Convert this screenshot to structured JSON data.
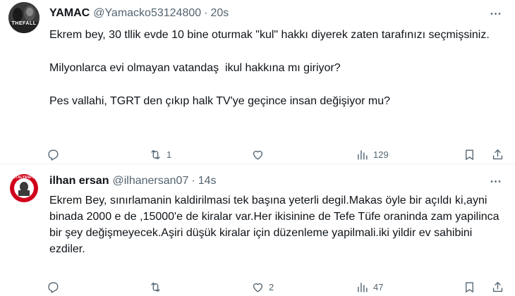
{
  "colors": {
    "text_primary": "#0f1419",
    "text_secondary": "#536471",
    "divider": "#eff3f4",
    "background": "#ffffff"
  },
  "tweets": [
    {
      "name": "YAMAC",
      "handle": "@Yamacko53124800",
      "dot": "·",
      "time": "20s",
      "avatar_text": "THEFALL",
      "paragraphs": [
        "Ekrem bey, 30 tllik evde 10 bine oturmak \"kul\" hakkı diyerek zaten tarafınızı seçmişsiniz.",
        "Milyonlarca evi olmayan vatandaş  ikul hakkına mı giriyor?",
        "Pes vallahi, TGRT den çıkıp halk TV'ye geçince insan değişiyor mu?"
      ],
      "actions": {
        "replies": "",
        "retweets": "1",
        "likes": "",
        "views": "129"
      },
      "icons": [
        "more-icon",
        "reply-icon",
        "retweet-icon",
        "like-icon",
        "views-icon",
        "bookmark-icon",
        "share-icon"
      ]
    },
    {
      "name": "ilhan ersan",
      "handle": "@ilhanersan07",
      "dot": "·",
      "time": "14s",
      "avatar_text": "ANTALYASPOR",
      "paragraphs": [
        "Ekrem Bey, sınırlamanin kaldirilmasi tek başına yeterli degil.Makas öyle bir açıldı ki,ayni binada 2000 e de ,15000'e de kiralar var.Her ikisinine de Tefe Tüfe oraninda zam yapilinca bir şey değişmeyecek.Aşiri düşük kiralar için düzenleme yapilmali.iki yildir ev sahibini ezdiler."
      ],
      "actions": {
        "replies": "",
        "retweets": "",
        "likes": "2",
        "views": "47"
      },
      "icons": [
        "more-icon",
        "reply-icon",
        "retweet-icon",
        "like-icon",
        "views-icon",
        "bookmark-icon",
        "share-icon"
      ]
    }
  ]
}
